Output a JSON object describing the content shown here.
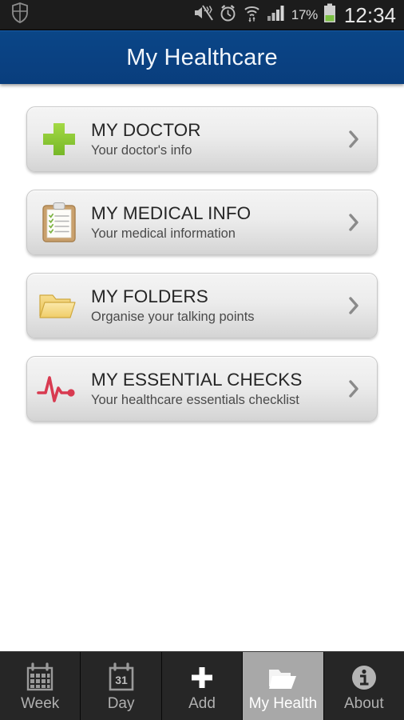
{
  "statusbar": {
    "left_icon": "shield-icon",
    "icons": [
      "mute-icon",
      "alarm-icon",
      "wifi-icon",
      "signal-icon"
    ],
    "battery_percent": "17%",
    "battery_icon": "battery-icon",
    "clock": "12:34"
  },
  "titlebar": {
    "title": "My Healthcare",
    "bg_color": "#0a4182",
    "text_color": "#f2f6fb"
  },
  "main": {
    "cards": [
      {
        "icon": "green-cross-icon",
        "icon_color": "#8cc63e",
        "title": "MY DOCTOR",
        "subtitle": "Your doctor's info",
        "chevron": "chevron-right-icon"
      },
      {
        "icon": "clipboard-icon",
        "icon_color": "#c8a06a",
        "title": "MY MEDICAL INFO",
        "subtitle": "Your medical information",
        "chevron": "chevron-right-icon"
      },
      {
        "icon": "folder-icon",
        "icon_color": "#f0cc66",
        "title": "MY FOLDERS",
        "subtitle": "Organise your talking points",
        "chevron": "chevron-right-icon"
      },
      {
        "icon": "heartbeat-icon",
        "icon_color": "#d93a4e",
        "title": "MY ESSENTIAL CHECKS",
        "subtitle": "Your healthcare essentials checklist",
        "chevron": "chevron-right-icon"
      }
    ]
  },
  "tabbar": {
    "tabs": [
      {
        "label": "Week",
        "icon": "calendar-week-icon",
        "selected": false
      },
      {
        "label": "Day",
        "icon": "calendar-day-icon",
        "day_number": "31",
        "selected": false
      },
      {
        "label": "Add",
        "icon": "plus-icon",
        "selected": false
      },
      {
        "label": "My Health",
        "icon": "folder-icon",
        "selected": true
      },
      {
        "label": "About",
        "icon": "info-icon",
        "selected": false
      }
    ],
    "selected_bg": "#a8a8a8"
  }
}
